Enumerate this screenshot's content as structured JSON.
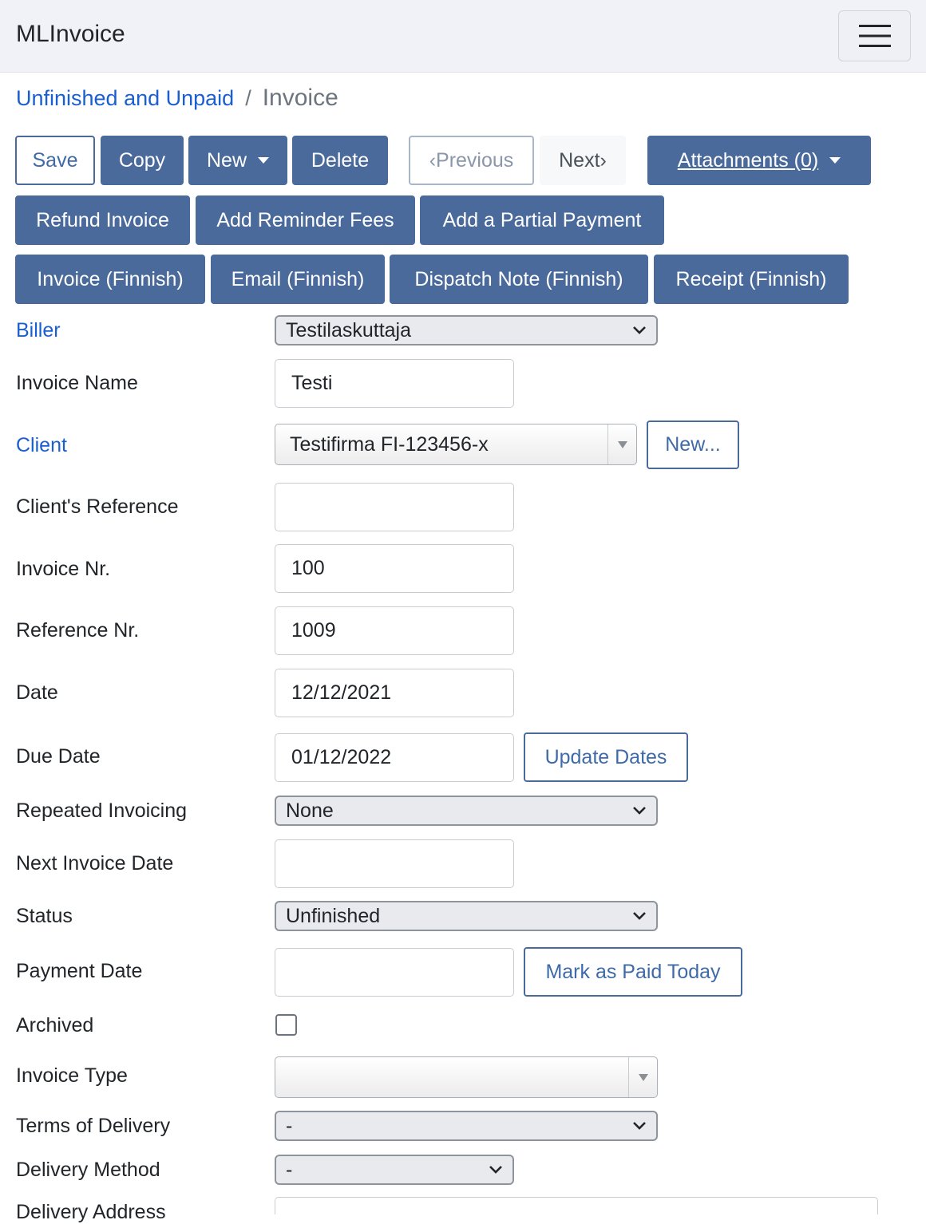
{
  "app": {
    "brand": "MLInvoice"
  },
  "breadcrumb": {
    "parent": "Unfinished and Unpaid",
    "separator": "/",
    "current": "Invoice"
  },
  "toolbar": {
    "save": "Save",
    "copy": "Copy",
    "new": "New",
    "delete": "Delete",
    "previous": "‹Previous",
    "next": "Next›",
    "attachments": "Attachments (0)",
    "refund": "Refund Invoice",
    "reminder_fees": "Add Reminder Fees",
    "partial_payment": "Add a Partial Payment",
    "invoice_print": "Invoice (Finnish)",
    "email_print": "Email (Finnish)",
    "dispatch_print": "Dispatch Note (Finnish)",
    "receipt_print": "Receipt (Finnish)"
  },
  "form": {
    "biller": {
      "label": "Biller",
      "value": "Testilaskuttaja"
    },
    "invoice_name": {
      "label": "Invoice Name",
      "value": "Testi"
    },
    "client": {
      "label": "Client",
      "value": "Testifirma FI-123456-x",
      "new_button": "New..."
    },
    "clients_reference": {
      "label": "Client's Reference",
      "value": ""
    },
    "invoice_nr": {
      "label": "Invoice Nr.",
      "value": "100"
    },
    "reference_nr": {
      "label": "Reference Nr.",
      "value": "1009"
    },
    "date": {
      "label": "Date",
      "value": "12/12/2021"
    },
    "due_date": {
      "label": "Due Date",
      "value": "01/12/2022",
      "button": "Update Dates"
    },
    "repeated_invoicing": {
      "label": "Repeated Invoicing",
      "value": "None"
    },
    "next_invoice_date": {
      "label": "Next Invoice Date",
      "value": ""
    },
    "status": {
      "label": "Status",
      "value": "Unfinished"
    },
    "payment_date": {
      "label": "Payment Date",
      "value": "",
      "button": "Mark as Paid Today"
    },
    "archived": {
      "label": "Archived",
      "checked": false
    },
    "invoice_type": {
      "label": "Invoice Type",
      "value": ""
    },
    "terms_of_delivery": {
      "label": "Terms of Delivery",
      "value": "-"
    },
    "delivery_method": {
      "label": "Delivery Method",
      "value": "-"
    },
    "delivery_address": {
      "label": "Delivery Address",
      "value": ""
    }
  },
  "colors": {
    "primary_button": "#4a6a9b",
    "link": "#1a5fd0",
    "navbar_bg": "#f0f2f8"
  },
  "icons": {
    "menu": "hamburger-menu-icon",
    "dropdown": "caret-down-icon",
    "select": "chevron-down-icon"
  }
}
